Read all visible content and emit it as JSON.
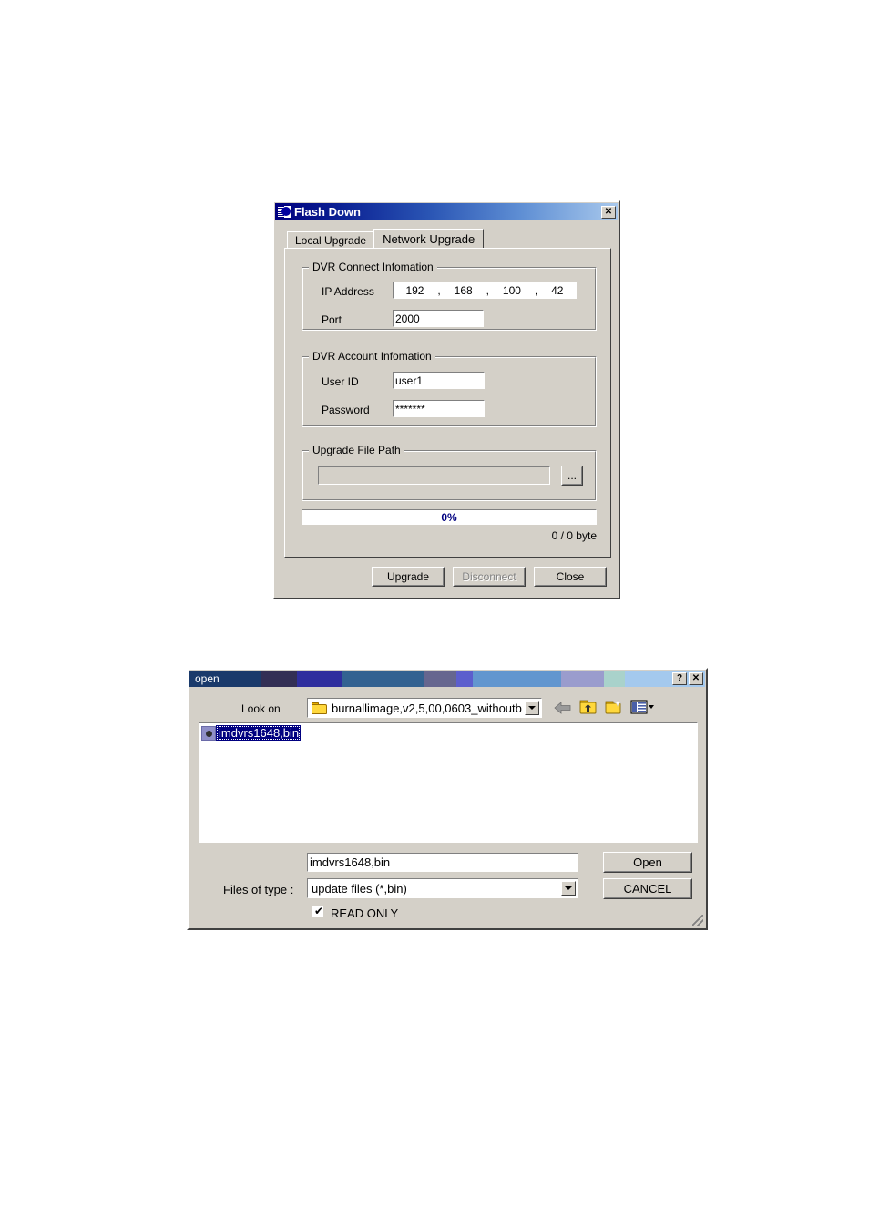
{
  "flash_down": {
    "title": "Flash Down",
    "icon": "flash-app-icon",
    "close_label": "✕",
    "tabs": [
      {
        "label": "Local Upgrade",
        "active": false
      },
      {
        "label": "Network Upgrade",
        "active": true
      }
    ],
    "connect_group": {
      "legend": "DVR Connect Infomation",
      "ip_label": "IP Address",
      "ip_octets": [
        "192",
        "168",
        "100",
        "42"
      ],
      "ip_sep": ",",
      "port_label": "Port",
      "port_value": "2000"
    },
    "account_group": {
      "legend": "DVR Account Infomation",
      "user_label": "User ID",
      "user_value": "user1",
      "password_label": "Password",
      "password_value": "*******"
    },
    "file_group": {
      "legend": "Upgrade File Path",
      "path_value": "",
      "browse_label": "..."
    },
    "progress": {
      "percent_label": "0%",
      "percent_value": 0,
      "bytes_label": "0 / 0 byte"
    },
    "buttons": [
      {
        "label": "Upgrade",
        "disabled": false
      },
      {
        "label": "Disconnect",
        "disabled": true
      },
      {
        "label": "Close",
        "disabled": false
      }
    ]
  },
  "open_dialog": {
    "title": "open",
    "help_label": "?",
    "close_label": "✕",
    "look_in_label": "Look on",
    "look_in_value": "burnallimage,v2,5,00,0603_withoutb",
    "toolbar_icons": [
      "back-arrow-icon",
      "up-folder-icon",
      "new-folder-icon",
      "view-menu-icon"
    ],
    "files": [
      {
        "name": "imdvrs1648,bin",
        "selected": true,
        "icon": "bin-file-icon"
      }
    ],
    "file_name_value": "imdvrs1648,bin",
    "files_of_type_label": "Files of type :",
    "files_of_type_value": "update files (*,bin)",
    "read_only_label": "READ ONLY",
    "read_only_checked": true,
    "check_glyph": "✔",
    "open_button": "Open",
    "cancel_button": "CANCEL"
  },
  "colors": {
    "dialog_face": "#d4d0c8",
    "title_active": "#000080",
    "selection": "#000080",
    "progress_text": "#000080"
  }
}
